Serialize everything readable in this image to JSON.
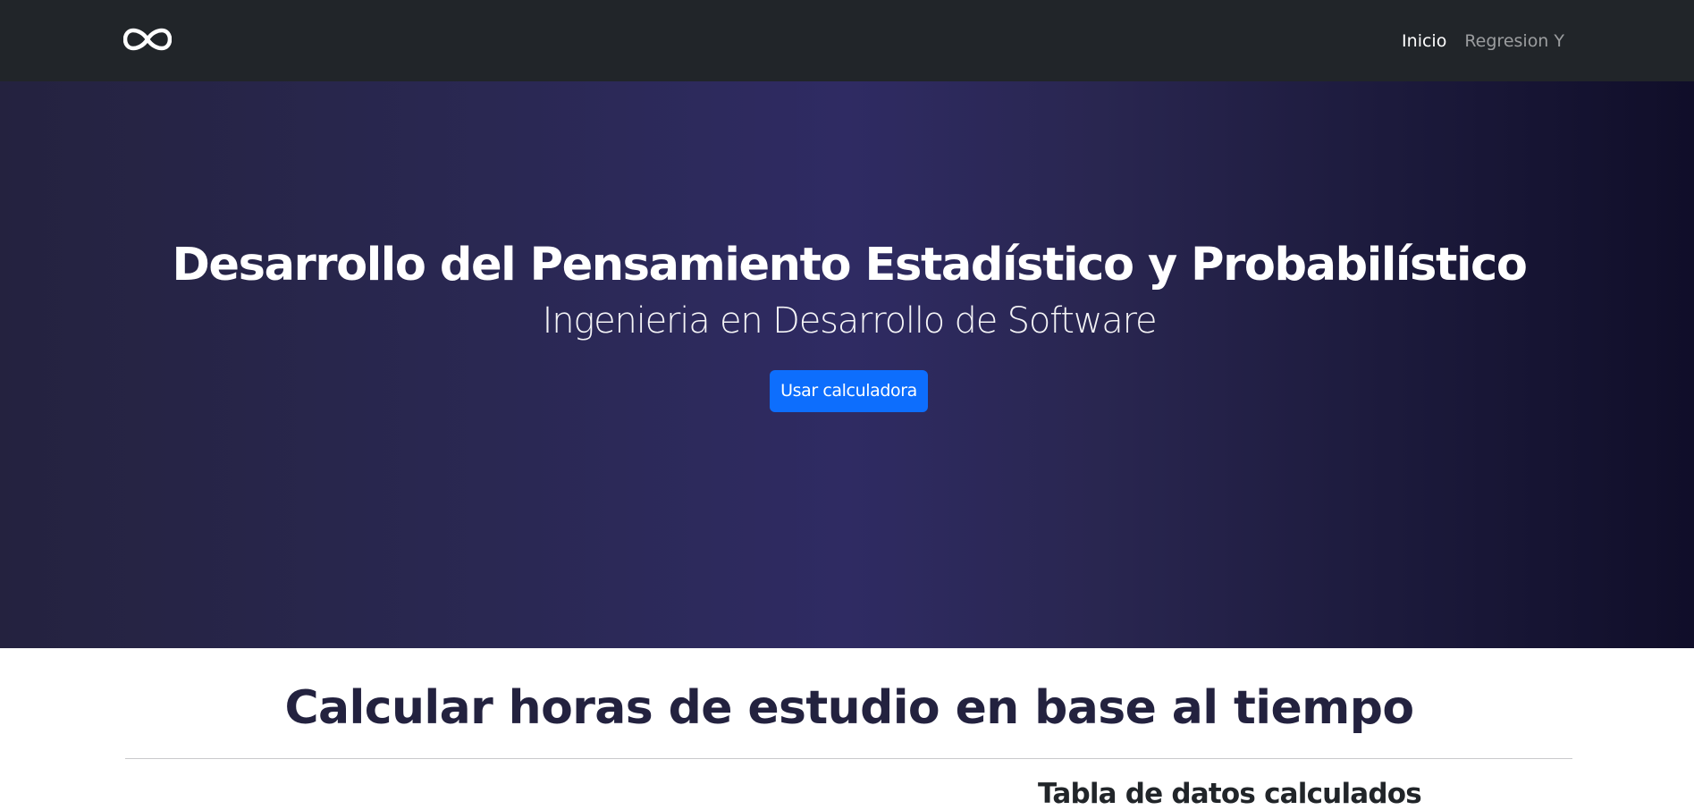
{
  "navbar": {
    "brand_icon": "infinity-icon",
    "links": [
      {
        "label": "Inicio",
        "active": true
      },
      {
        "label": "Regresion Y",
        "active": false
      }
    ],
    "background": "#212529"
  },
  "hero": {
    "title": "Desarrollo del Pensamiento Estadístico y Probabilístico",
    "subtitle": "Ingenieria en Desarrollo de Software",
    "button_label": "Usar calculadora",
    "button_color": "#0d6efd",
    "background": "#2a2853"
  },
  "main": {
    "section_title": "Calcular horas de estudio en base al tiempo",
    "table_heading": "Tabla de datos calculados"
  }
}
